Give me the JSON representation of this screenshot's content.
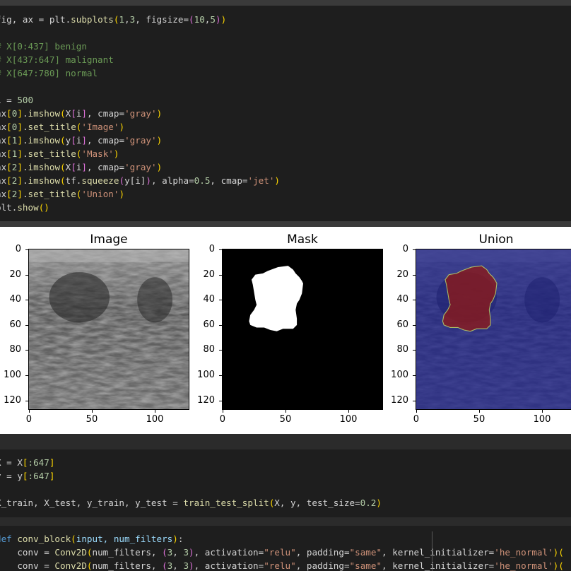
{
  "cell1": {
    "lines": [
      [
        {
          "t": "fig, ax = plt.",
          "c": ""
        },
        {
          "t": "subplots",
          "c": "fn"
        },
        {
          "t": "(",
          "c": "pa"
        },
        {
          "t": "1",
          "c": "nm"
        },
        {
          "t": ",",
          "c": ""
        },
        {
          "t": "3",
          "c": "nm"
        },
        {
          "t": ", figsize=",
          "c": ""
        },
        {
          "t": "(",
          "c": "pb"
        },
        {
          "t": "10",
          "c": "nm"
        },
        {
          "t": ",",
          "c": ""
        },
        {
          "t": "5",
          "c": "nm"
        },
        {
          "t": ")",
          "c": "pb"
        },
        {
          "t": ")",
          "c": "pa"
        }
      ],
      [],
      [
        {
          "t": "# X[0:437] benign",
          "c": "cm"
        }
      ],
      [
        {
          "t": "# X[437:647] malignant",
          "c": "cm"
        }
      ],
      [
        {
          "t": "# X[647:780] normal",
          "c": "cm"
        }
      ],
      [],
      [
        {
          "t": "i = ",
          "c": ""
        },
        {
          "t": "500",
          "c": "nm"
        }
      ],
      [
        {
          "t": "ax",
          "c": ""
        },
        {
          "t": "[",
          "c": "pa"
        },
        {
          "t": "0",
          "c": "nm"
        },
        {
          "t": "]",
          "c": "pa"
        },
        {
          "t": ".",
          "c": ""
        },
        {
          "t": "imshow",
          "c": "fn"
        },
        {
          "t": "(",
          "c": "pa"
        },
        {
          "t": "X",
          "c": ""
        },
        {
          "t": "[",
          "c": "pb"
        },
        {
          "t": "i",
          "c": ""
        },
        {
          "t": "]",
          "c": "pb"
        },
        {
          "t": ", cmap=",
          "c": ""
        },
        {
          "t": "'gray'",
          "c": "st"
        },
        {
          "t": ")",
          "c": "pa"
        }
      ],
      [
        {
          "t": "ax",
          "c": ""
        },
        {
          "t": "[",
          "c": "pa"
        },
        {
          "t": "0",
          "c": "nm"
        },
        {
          "t": "]",
          "c": "pa"
        },
        {
          "t": ".",
          "c": ""
        },
        {
          "t": "set_title",
          "c": "fn"
        },
        {
          "t": "(",
          "c": "pa"
        },
        {
          "t": "'Image'",
          "c": "st"
        },
        {
          "t": ")",
          "c": "pa"
        }
      ],
      [
        {
          "t": "ax",
          "c": ""
        },
        {
          "t": "[",
          "c": "pa"
        },
        {
          "t": "1",
          "c": "nm"
        },
        {
          "t": "]",
          "c": "pa"
        },
        {
          "t": ".",
          "c": ""
        },
        {
          "t": "imshow",
          "c": "fn"
        },
        {
          "t": "(",
          "c": "pa"
        },
        {
          "t": "y",
          "c": ""
        },
        {
          "t": "[",
          "c": "pb"
        },
        {
          "t": "i",
          "c": ""
        },
        {
          "t": "]",
          "c": "pb"
        },
        {
          "t": ", cmap=",
          "c": ""
        },
        {
          "t": "'gray'",
          "c": "st"
        },
        {
          "t": ")",
          "c": "pa"
        }
      ],
      [
        {
          "t": "ax",
          "c": ""
        },
        {
          "t": "[",
          "c": "pa"
        },
        {
          "t": "1",
          "c": "nm"
        },
        {
          "t": "]",
          "c": "pa"
        },
        {
          "t": ".",
          "c": ""
        },
        {
          "t": "set_title",
          "c": "fn"
        },
        {
          "t": "(",
          "c": "pa"
        },
        {
          "t": "'Mask'",
          "c": "st"
        },
        {
          "t": ")",
          "c": "pa"
        }
      ],
      [
        {
          "t": "ax",
          "c": ""
        },
        {
          "t": "[",
          "c": "pa"
        },
        {
          "t": "2",
          "c": "nm"
        },
        {
          "t": "]",
          "c": "pa"
        },
        {
          "t": ".",
          "c": ""
        },
        {
          "t": "imshow",
          "c": "fn"
        },
        {
          "t": "(",
          "c": "pa"
        },
        {
          "t": "X",
          "c": ""
        },
        {
          "t": "[",
          "c": "pb"
        },
        {
          "t": "i",
          "c": ""
        },
        {
          "t": "]",
          "c": "pb"
        },
        {
          "t": ", cmap=",
          "c": ""
        },
        {
          "t": "'gray'",
          "c": "st"
        },
        {
          "t": ")",
          "c": "pa"
        }
      ],
      [
        {
          "t": "ax",
          "c": ""
        },
        {
          "t": "[",
          "c": "pa"
        },
        {
          "t": "2",
          "c": "nm"
        },
        {
          "t": "]",
          "c": "pa"
        },
        {
          "t": ".",
          "c": ""
        },
        {
          "t": "imshow",
          "c": "fn"
        },
        {
          "t": "(",
          "c": "pa"
        },
        {
          "t": "tf.",
          "c": ""
        },
        {
          "t": "squeeze",
          "c": "fn"
        },
        {
          "t": "(",
          "c": "pb"
        },
        {
          "t": "y[i]",
          "c": ""
        },
        {
          "t": ")",
          "c": "pb"
        },
        {
          "t": ", alpha=",
          "c": ""
        },
        {
          "t": "0.5",
          "c": "nm"
        },
        {
          "t": ", cmap=",
          "c": ""
        },
        {
          "t": "'jet'",
          "c": "st"
        },
        {
          "t": ")",
          "c": "pa"
        }
      ],
      [
        {
          "t": "ax",
          "c": ""
        },
        {
          "t": "[",
          "c": "pa"
        },
        {
          "t": "2",
          "c": "nm"
        },
        {
          "t": "]",
          "c": "pa"
        },
        {
          "t": ".",
          "c": ""
        },
        {
          "t": "set_title",
          "c": "fn"
        },
        {
          "t": "(",
          "c": "pa"
        },
        {
          "t": "'Union'",
          "c": "st"
        },
        {
          "t": ")",
          "c": "pa"
        }
      ],
      [
        {
          "t": "plt.",
          "c": ""
        },
        {
          "t": "show",
          "c": "fn"
        },
        {
          "t": "()",
          "c": "pa"
        }
      ]
    ]
  },
  "figure": {
    "panels": [
      {
        "title": "Image",
        "kind": "ultrasound"
      },
      {
        "title": "Mask",
        "kind": "mask"
      },
      {
        "title": "Union",
        "kind": "union"
      }
    ],
    "yticks": [
      "0",
      "20",
      "40",
      "60",
      "80",
      "100",
      "120"
    ],
    "xticks": [
      "0",
      "50",
      "100"
    ],
    "colors": {
      "mask_fg": "#ffffff",
      "mask_bg": "#000000",
      "jet_low": "#1a1f8c",
      "jet_high": "#8b1a1a"
    }
  },
  "cell2": {
    "lines": [
      [
        {
          "t": "X = X",
          "c": ""
        },
        {
          "t": "[",
          "c": "pa"
        },
        {
          "t": ":647",
          "c": "nm"
        },
        {
          "t": "]",
          "c": "pa"
        }
      ],
      [
        {
          "t": "y = y",
          "c": ""
        },
        {
          "t": "[",
          "c": "pa"
        },
        {
          "t": ":647",
          "c": "nm"
        },
        {
          "t": "]",
          "c": "pa"
        }
      ],
      [],
      [
        {
          "t": "X_train, X_test, y_train, y_test = ",
          "c": ""
        },
        {
          "t": "train_test_split",
          "c": "fn"
        },
        {
          "t": "(",
          "c": "pa"
        },
        {
          "t": "X, y, test_size=",
          "c": ""
        },
        {
          "t": "0.2",
          "c": "nm"
        },
        {
          "t": ")",
          "c": "pa"
        }
      ]
    ]
  },
  "cell3": {
    "lines": [
      [
        {
          "t": "def ",
          "c": "kw"
        },
        {
          "t": "conv_block",
          "c": "fn"
        },
        {
          "t": "(",
          "c": "pa"
        },
        {
          "t": "input, num_filters",
          "c": "id"
        },
        {
          "t": ")",
          "c": "pa"
        },
        {
          "t": ":",
          "c": ""
        }
      ],
      [
        {
          "t": "    conv = ",
          "c": ""
        },
        {
          "t": "Conv2D",
          "c": "fn"
        },
        {
          "t": "(",
          "c": "pa"
        },
        {
          "t": "num_filters, ",
          "c": ""
        },
        {
          "t": "(",
          "c": "pb"
        },
        {
          "t": "3",
          "c": "nm"
        },
        {
          "t": ", ",
          "c": ""
        },
        {
          "t": "3",
          "c": "nm"
        },
        {
          "t": ")",
          "c": "pb"
        },
        {
          "t": ", activation=",
          "c": ""
        },
        {
          "t": "\"relu\"",
          "c": "st"
        },
        {
          "t": ", padding=",
          "c": ""
        },
        {
          "t": "\"same\"",
          "c": "st"
        },
        {
          "t": ", kernel_initializer=",
          "c": ""
        },
        {
          "t": "'he_normal'",
          "c": "st"
        },
        {
          "t": ")(",
          "c": "pa"
        }
      ],
      [
        {
          "t": "    conv = ",
          "c": ""
        },
        {
          "t": "Conv2D",
          "c": "fn"
        },
        {
          "t": "(",
          "c": "pa"
        },
        {
          "t": "num_filters, ",
          "c": ""
        },
        {
          "t": "(",
          "c": "pb"
        },
        {
          "t": "3",
          "c": "nm"
        },
        {
          "t": ", ",
          "c": ""
        },
        {
          "t": "3",
          "c": "nm"
        },
        {
          "t": ")",
          "c": "pb"
        },
        {
          "t": ", activation=",
          "c": ""
        },
        {
          "t": "\"relu\"",
          "c": "st"
        },
        {
          "t": ", padding=",
          "c": ""
        },
        {
          "t": "\"same\"",
          "c": "st"
        },
        {
          "t": ", kernel_initializer=",
          "c": ""
        },
        {
          "t": "'he_normal'",
          "c": "st"
        },
        {
          "t": ")(",
          "c": "pa"
        }
      ]
    ]
  }
}
